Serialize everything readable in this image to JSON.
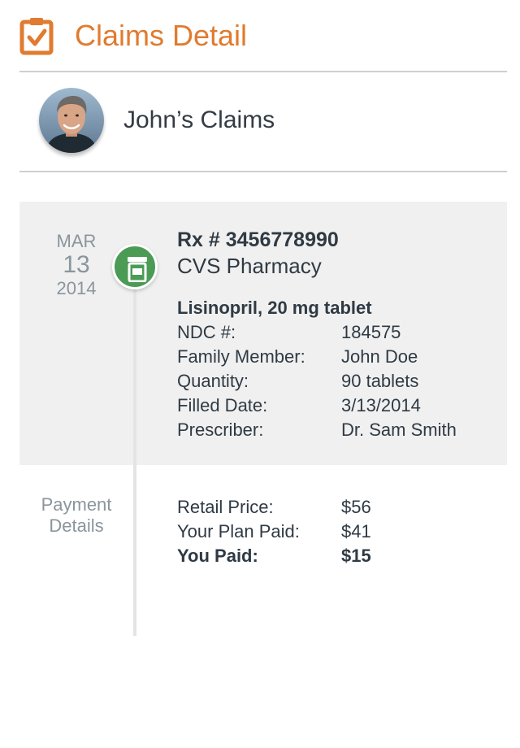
{
  "header": {
    "title": "Claims Detail",
    "icon": "clipboard-check-icon",
    "accent_color": "#e07b2f"
  },
  "user": {
    "claims_title": "John’s Claims"
  },
  "claim": {
    "date": {
      "month": "MAR",
      "day": "13",
      "year": "2014"
    },
    "badge_icon": "pill-bottle-icon",
    "badge_color": "#4b9b55",
    "rx_number": "Rx # 3456778990",
    "pharmacy": "CVS Pharmacy",
    "drug": "Lisinopril, 20 mg tablet",
    "details": [
      {
        "label": "NDC #:",
        "value": "184575"
      },
      {
        "label": "Family Member:",
        "value": "John Doe"
      },
      {
        "label": "Quantity:",
        "value": "90 tablets"
      },
      {
        "label": "Filled Date:",
        "value": "3/13/2014"
      },
      {
        "label": "Prescriber:",
        "value": "Dr. Sam Smith"
      }
    ]
  },
  "payment": {
    "heading_line1": "Payment",
    "heading_line2": "Details",
    "rows": [
      {
        "label": "Retail Price:",
        "value": "$56"
      },
      {
        "label": "Your Plan Paid:",
        "value": "$41"
      },
      {
        "label": "You Paid:",
        "value": "$15"
      }
    ]
  }
}
